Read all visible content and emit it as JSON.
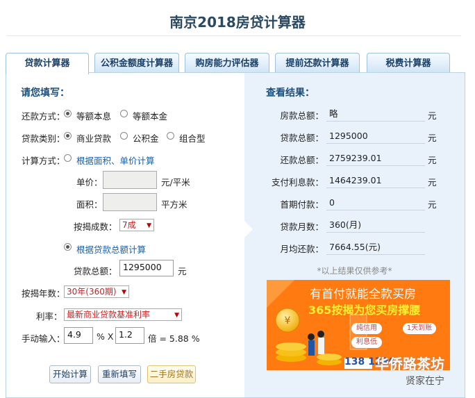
{
  "page": {
    "title": "南京2018房贷计算器"
  },
  "tabs": [
    {
      "label": "贷款计算器",
      "active": true
    },
    {
      "label": "公积金额度计算器",
      "active": false
    },
    {
      "label": "购房能力评估器",
      "active": false
    },
    {
      "label": "提前还款计算器",
      "active": false
    },
    {
      "label": "税费计算器",
      "active": false
    }
  ],
  "form": {
    "heading": "请您填写：",
    "repay_label": "还款方式：",
    "repay_options": [
      "等额本息",
      "等额本金"
    ],
    "repay_selected": 0,
    "loan_type_label": "贷款类别：",
    "loan_type_options": [
      "商业贷款",
      "公积金",
      "组合型"
    ],
    "loan_type_selected": 0,
    "calc_label": "计算方式：",
    "calc_by_area": "根据面积、单价计算",
    "unit_price_label": "单价：",
    "unit_price_unit": "元/平米",
    "area_label": "面积：",
    "area_unit": "平方米",
    "ratio_label": "按揭成数：",
    "ratio_value": "7成",
    "calc_by_total": "根据贷款总额计算",
    "loan_total_label": "贷款总额：",
    "loan_total_value": "1295000",
    "loan_total_unit": "元",
    "years_label": "按揭年数：",
    "years_value": "30年(360期)",
    "rate_label": "利率：",
    "rate_value": "最新商业贷款基准利率",
    "manual_label": "手动输入：",
    "manual_rate": "4.9",
    "pct_x": "% X",
    "multiplier": "1.2",
    "result_text": "倍 = 5.88 %"
  },
  "buttons": {
    "start": "开始计算",
    "reset": "重新填写",
    "second_hand": "二手房贷款"
  },
  "results": {
    "heading": "查看结果：",
    "rows": [
      {
        "label": "房款总额：",
        "value": "略",
        "unit": "元"
      },
      {
        "label": "贷款总额：",
        "value": "1295000",
        "unit": "元"
      },
      {
        "label": "还款总额：",
        "value": "2759239.01",
        "unit": "元"
      },
      {
        "label": "支付利息款：",
        "value": "1464239.01",
        "unit": "元"
      },
      {
        "label": "首期付款：",
        "value": "0",
        "unit": "元"
      },
      {
        "label": "贷款月数：",
        "value": "360(月)",
        "unit": ""
      },
      {
        "label": "月均还款：",
        "value": "7664.55(元)",
        "unit": ""
      }
    ],
    "note": "*以上结果仅供参考*"
  },
  "ad": {
    "headline": "有首付就能全款买房",
    "subline": "365按揭为您买房撑腰",
    "tags": [
      "纯信用",
      "利息低",
      "1天到账"
    ],
    "phone": "138 1396 ...",
    "watermark": "华侨路茶坊",
    "watermark2": "贤家在宁"
  },
  "colors": {
    "accent": "#1a3f66",
    "select_text": "#cc1f1f",
    "ad_orange": "#ff7a10"
  }
}
